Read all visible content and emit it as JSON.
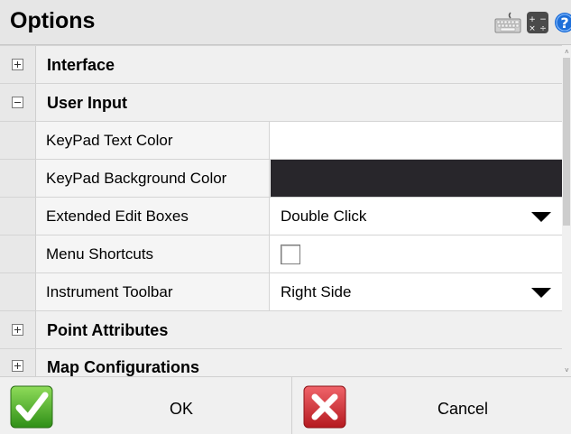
{
  "window": {
    "title": "Options"
  },
  "toolbar_icons": [
    "keyboard-icon",
    "calculator-icon",
    "help-icon"
  ],
  "categories": [
    {
      "label": "Interface",
      "expanded": false
    },
    {
      "label": "User Input",
      "expanded": true
    },
    {
      "label": "Point Attributes",
      "expanded": false
    },
    {
      "label": "Map Configurations",
      "expanded": false
    }
  ],
  "user_input": {
    "keypad_text_color": {
      "name": "KeyPad Text Color",
      "value_color": "#ffffff"
    },
    "keypad_background_color": {
      "name": "KeyPad Background Color",
      "value_color": "#28262b"
    },
    "extended_edit_boxes": {
      "name": "Extended Edit Boxes",
      "value": "Double Click"
    },
    "menu_shortcuts": {
      "name": "Menu Shortcuts",
      "checked": false
    },
    "instrument_toolbar": {
      "name": "Instrument Toolbar",
      "value": "Right Side"
    }
  },
  "buttons": {
    "ok": "OK",
    "cancel": "Cancel"
  },
  "colors": {
    "ok_icon": "#4caf26",
    "cancel_icon": "#d9242a",
    "help_icon": "#1e6fd9"
  }
}
